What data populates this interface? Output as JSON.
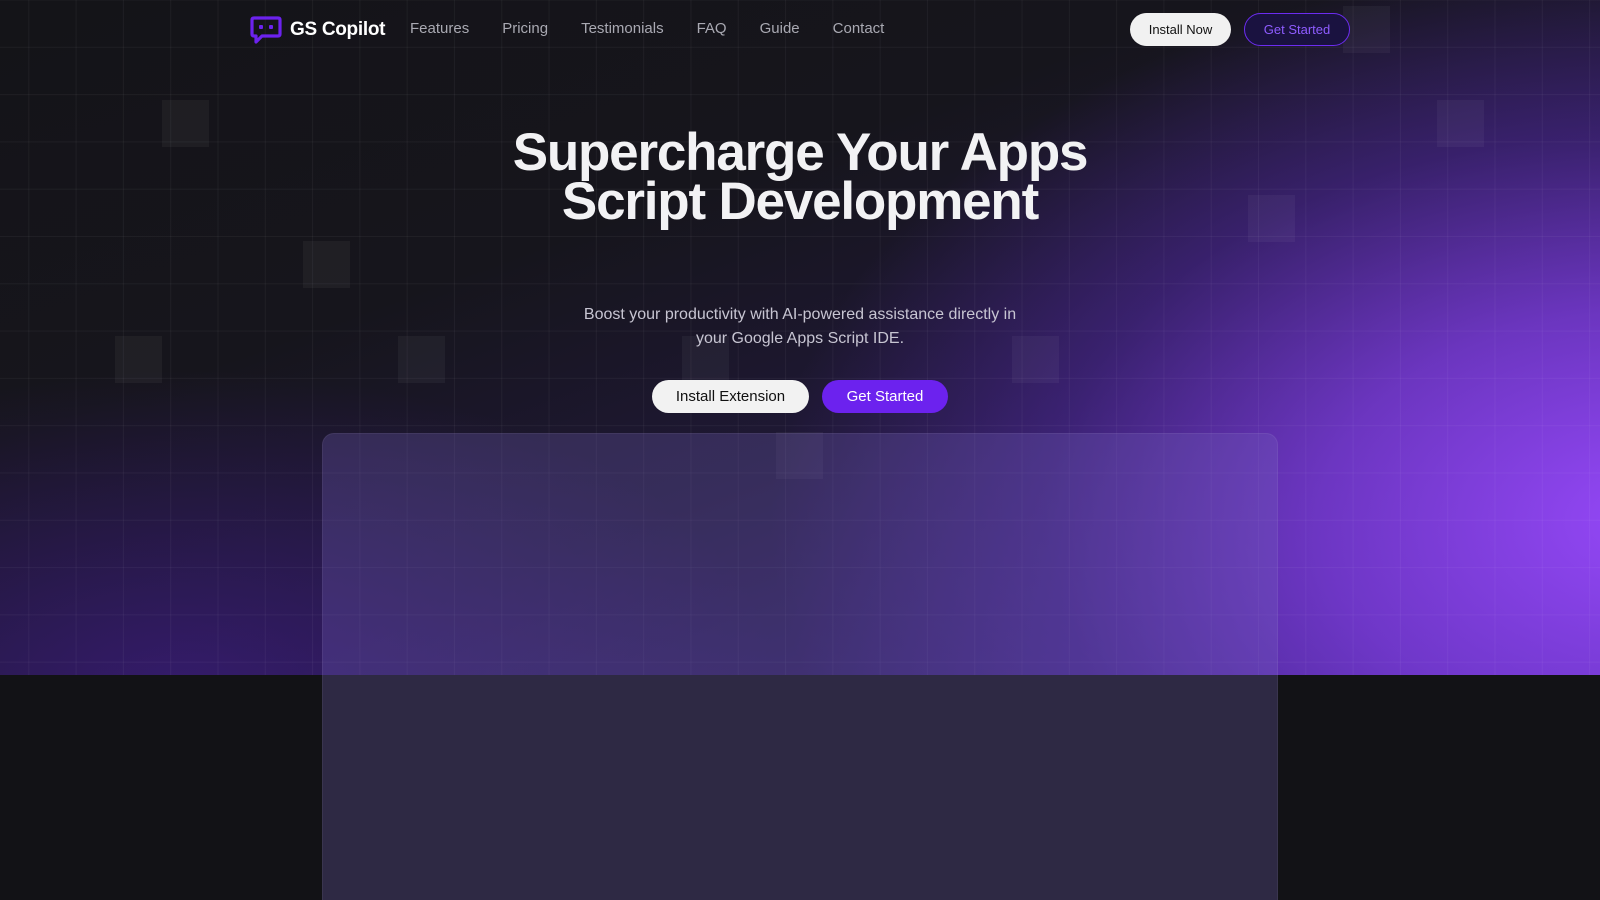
{
  "brand": {
    "name": "GS Copilot",
    "icon": "chat-bubble-icon",
    "accent_color": "#6c22ee"
  },
  "nav": {
    "links": [
      "Features",
      "Pricing",
      "Testimonials",
      "FAQ",
      "Guide",
      "Contact"
    ],
    "install_label": "Install Now",
    "get_started_label": "Get Started"
  },
  "hero": {
    "title": "Supercharge Your Apps Script Development",
    "subtitle": "Boost your productivity with AI-powered assistance directly in your Google Apps Script IDE.",
    "install_extension_label": "Install Extension",
    "get_started_label": "Get Started"
  },
  "colors": {
    "background": "#121216",
    "hero_gradient_end": "#9a4aff",
    "nav_link": "#a9a9b2"
  }
}
